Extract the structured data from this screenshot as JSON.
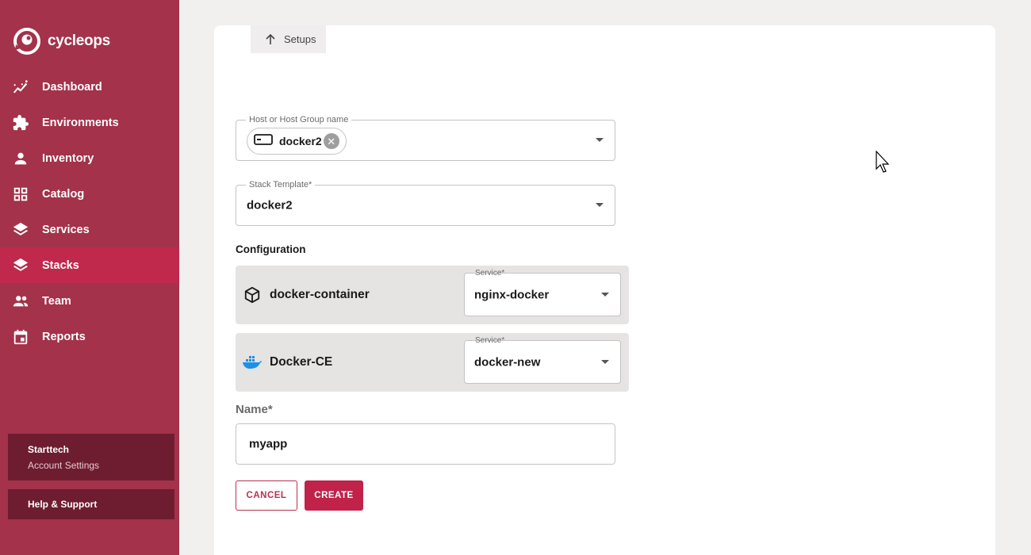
{
  "brand": {
    "name": "cycleops",
    "accent": "#a3324a",
    "active": "#c0284c"
  },
  "sidebar": {
    "items": [
      {
        "label": "Dashboard",
        "icon": "chart-line-icon",
        "active": false
      },
      {
        "label": "Environments",
        "icon": "puzzle-icon",
        "active": false
      },
      {
        "label": "Inventory",
        "icon": "person-icon",
        "active": false
      },
      {
        "label": "Catalog",
        "icon": "grid-icon",
        "active": false
      },
      {
        "label": "Services",
        "icon": "layers-icon",
        "active": false
      },
      {
        "label": "Stacks",
        "icon": "layers-icon",
        "active": true
      },
      {
        "label": "Team",
        "icon": "people-icon",
        "active": false
      },
      {
        "label": "Reports",
        "icon": "calendar-icon",
        "active": false
      }
    ],
    "account": {
      "name": "Starttech",
      "settings_label": "Account Settings"
    },
    "help_label": "Help & Support"
  },
  "main": {
    "back_label": "Setups",
    "host_field": {
      "legend": "Host or Host Group name",
      "chip": "docker2"
    },
    "stack_template": {
      "legend": "Stack Template*",
      "value": "docker2"
    },
    "configuration_label": "Configuration",
    "config_rows": [
      {
        "name": "docker-container",
        "icon": "cube-icon",
        "service_legend": "Service*",
        "service_value": "nginx-docker"
      },
      {
        "name": "Docker-CE",
        "icon": "docker-whale-icon",
        "service_legend": "Service*",
        "service_value": "docker-new"
      }
    ],
    "name_field": {
      "label": "Name*",
      "value": "myapp"
    },
    "cancel_label": "CANCEL",
    "create_label": "CREATE"
  }
}
